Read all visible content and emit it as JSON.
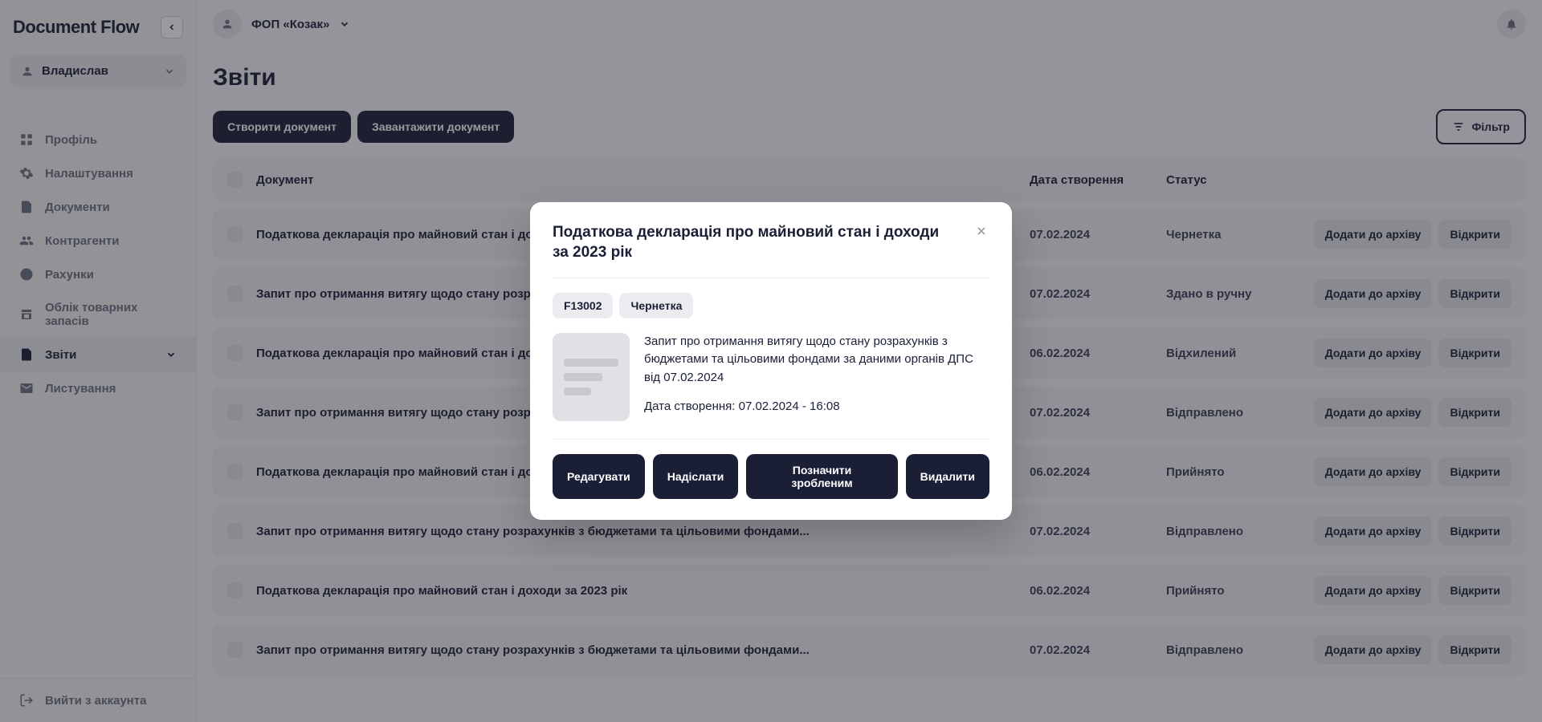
{
  "app": {
    "name": "Document Flow"
  },
  "sidebar": {
    "user": "Владислав",
    "items": [
      {
        "label": "Профіль",
        "icon": "grid"
      },
      {
        "label": "Налаштування",
        "icon": "gear"
      },
      {
        "label": "Документи",
        "icon": "file"
      },
      {
        "label": "Контрагенти",
        "icon": "users"
      },
      {
        "label": "Рахунки",
        "icon": "dollar"
      },
      {
        "label": "Облік товарних запасів",
        "icon": "store"
      },
      {
        "label": "Звіти",
        "icon": "report",
        "active": true,
        "expandable": true
      },
      {
        "label": "Листування",
        "icon": "mail"
      }
    ],
    "logout": "Вийти з аккаунта"
  },
  "topbar": {
    "org": "ФОП «Козак»"
  },
  "page": {
    "title": "Звіти",
    "create_btn": "Створити документ",
    "upload_btn": "Завантажити документ",
    "filter_btn": "Фільтр",
    "columns": {
      "doc": "Документ",
      "date": "Дата створення",
      "status": "Статус"
    },
    "row_actions": {
      "archive": "Додати до архіву",
      "open": "Відкрити"
    },
    "rows": [
      {
        "doc": "Податкова декларація про майновий стан і доходи за 2023 рік",
        "date": "07.02.2024",
        "status": "Чернетка"
      },
      {
        "doc": "Запит про отримання витягу щодо стану розрахунків з бюджетами та цільовими фондами...",
        "date": "07.02.2024",
        "status": "Здано в ручну"
      },
      {
        "doc": "Податкова декларація про майновий стан і доходи за 2023 рік",
        "date": "06.02.2024",
        "status": "Відхилений"
      },
      {
        "doc": "Запит про отримання витягу щодо стану розрахунків з бюджетами та цільовими фондами...",
        "date": "07.02.2024",
        "status": "Відправлено"
      },
      {
        "doc": "Податкова декларація про майновий стан і доходи за 2023 рік",
        "date": "06.02.2024",
        "status": "Прийнято"
      },
      {
        "doc": "Запит про отримання витягу щодо стану розрахунків з бюджетами та цільовими фондами...",
        "date": "07.02.2024",
        "status": "Відправлено"
      },
      {
        "doc": "Податкова декларація про майновий стан і доходи за 2023 рік",
        "date": "06.02.2024",
        "status": "Прийнято"
      },
      {
        "doc": "Запит про отримання витягу щодо стану розрахунків з бюджетами та цільовими фондами...",
        "date": "07.02.2024",
        "status": "Відправлено"
      }
    ]
  },
  "modal": {
    "title": "Податкова декларація про майновий стан і доходи за 2023 рік",
    "code": "F13002",
    "status": "Чернетка",
    "description": "Запит про отримання витягу щодо стану розрахунків з бюджетами та цільовими фондами за даними органів ДПС від 07.02.2024",
    "created": "Дата створення: 07.02.2024 - 16:08",
    "actions": {
      "edit": "Редагувати",
      "send": "Надіслати",
      "mark_done": "Позначити зробленим",
      "delete": "Видалити"
    }
  }
}
